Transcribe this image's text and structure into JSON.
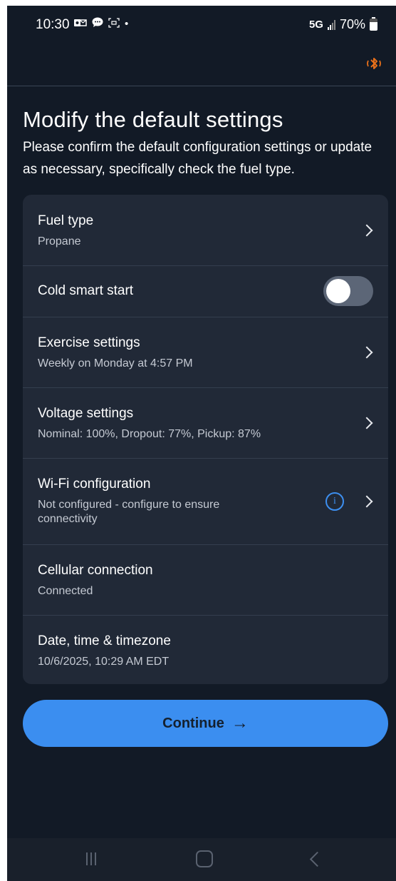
{
  "status_bar": {
    "time": "10:30",
    "dot": "•",
    "network": "5G",
    "battery": "70%"
  },
  "app_bar": {
    "icon": "bluetooth-icon",
    "accent_color": "#e8701a"
  },
  "page": {
    "title": "Modify the default settings",
    "description": "Please confirm the default configuration settings or update as necessary, specifically check the fuel type."
  },
  "settings": [
    {
      "title": "Fuel type",
      "subtitle": "Propane"
    },
    {
      "title": "Cold smart start",
      "toggle_on": false
    },
    {
      "title": "Exercise settings",
      "subtitle": "Weekly on Monday at 4:57 PM"
    },
    {
      "title": "Voltage settings",
      "subtitle": "Nominal: 100%, Dropout: 77%, Pickup: 87%"
    },
    {
      "title": "Wi-Fi configuration",
      "subtitle": "Not configured - configure to ensure connectivity",
      "info_icon": "info-icon"
    },
    {
      "title": "Cellular connection",
      "subtitle": "Connected"
    },
    {
      "title": "Date, time & timezone",
      "subtitle": "10/6/2025, 10:29 AM EDT"
    }
  ],
  "continue_button": {
    "label": "Continue",
    "arrow": "→",
    "color": "#3b8ef0"
  },
  "info_glyph": "i"
}
